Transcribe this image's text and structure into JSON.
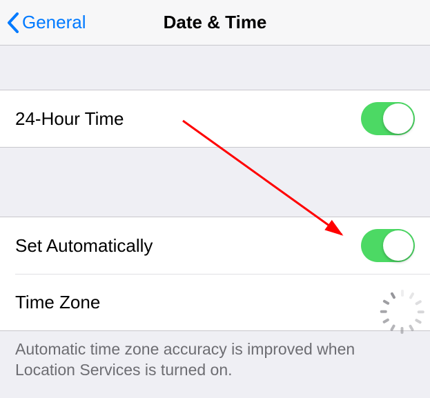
{
  "navbar": {
    "back_label": "General",
    "title": "Date & Time"
  },
  "rows": {
    "twenty_four_hour": {
      "label": "24-Hour Time",
      "on": true
    },
    "set_automatically": {
      "label": "Set Automatically",
      "on": true
    },
    "time_zone": {
      "label": "Time Zone"
    }
  },
  "footer": "Automatic time zone accuracy is improved when Location Services is turned on."
}
